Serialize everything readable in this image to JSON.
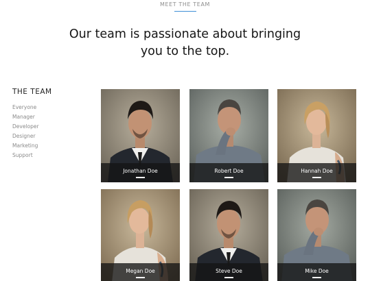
{
  "section": {
    "eyebrow": "MEET THE TEAM",
    "headline_line1": "Our team is passionate about bringing",
    "headline_line2": "you to the top."
  },
  "sidebar": {
    "title": "THE TEAM",
    "filters": [
      "Everyone",
      "Manager",
      "Developer",
      "Designer",
      "Marketing",
      "Support"
    ]
  },
  "members": [
    {
      "name": "Jonathan Doe"
    },
    {
      "name": "Robert Doe"
    },
    {
      "name": "Hannah Doe"
    },
    {
      "name": "Megan Doe"
    },
    {
      "name": "Steve Doe"
    },
    {
      "name": "Mike Doe"
    }
  ],
  "colors": {
    "accent": "#3d8fd6",
    "caption_bg": "#141414",
    "filter_text": "#8a8a8a"
  }
}
